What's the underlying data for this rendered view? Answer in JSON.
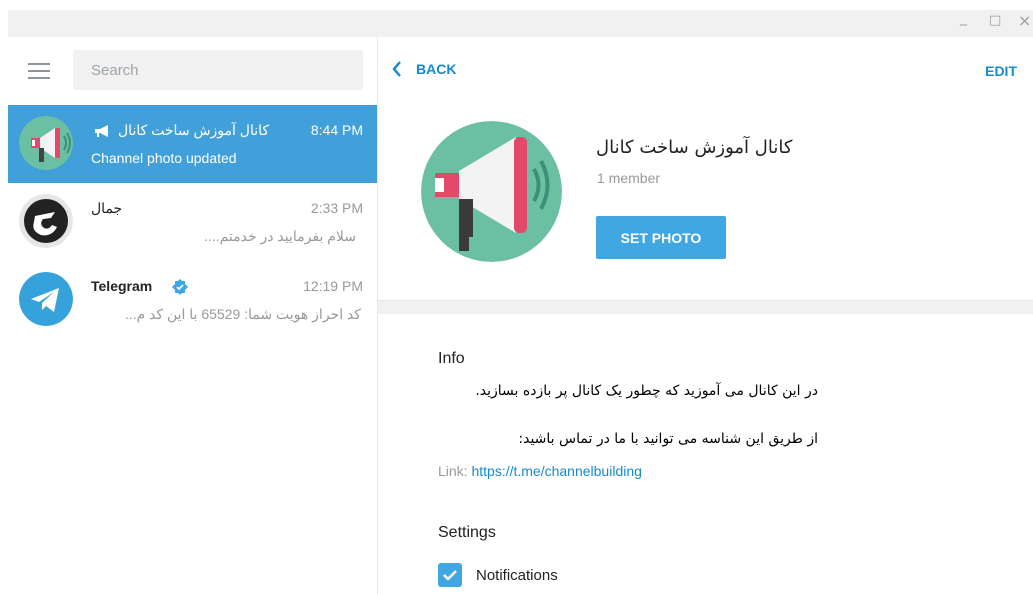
{
  "window": {
    "min_glyph": "_",
    "max_glyph": "□",
    "close_glyph": "×"
  },
  "sidebar": {
    "search_placeholder": "Search",
    "chats": [
      {
        "name": "کانال آموزش ساخت کانال",
        "time": "8:44 PM",
        "message": "Channel photo updated",
        "active": true,
        "icon": "megaphone-avatar"
      },
      {
        "name": "جمال",
        "time": "2:33 PM",
        "message": "سلام بفرمایید در خدمتم....",
        "active": false,
        "icon": "letter-j-avatar"
      },
      {
        "name": "Telegram",
        "time": "12:19 PM",
        "message": "کد احراز هویت شما: 65529 با این کد م...",
        "active": false,
        "icon": "telegram-avatar"
      }
    ]
  },
  "header": {
    "back_label": "BACK",
    "edit_label": "EDIT"
  },
  "channel": {
    "title": "کانال آموزش ساخت کانال",
    "members": "1 member",
    "set_photo_label": "SET PHOTO"
  },
  "info": {
    "heading": "Info",
    "line1": "در این کانال می آموزید که چطور یک کانال پر بازده بسازید.",
    "line2": "از طریق این شناسه می توانید با ما در تماس باشید:",
    "link_label": "Link:",
    "link_url": "https://t.me/channelbuilding"
  },
  "settings": {
    "heading": "Settings",
    "notifications_label": "Notifications",
    "notifications_checked": true
  },
  "colors": {
    "accent": "#419fd9",
    "link": "#168acd",
    "button": "#40a7e3"
  }
}
